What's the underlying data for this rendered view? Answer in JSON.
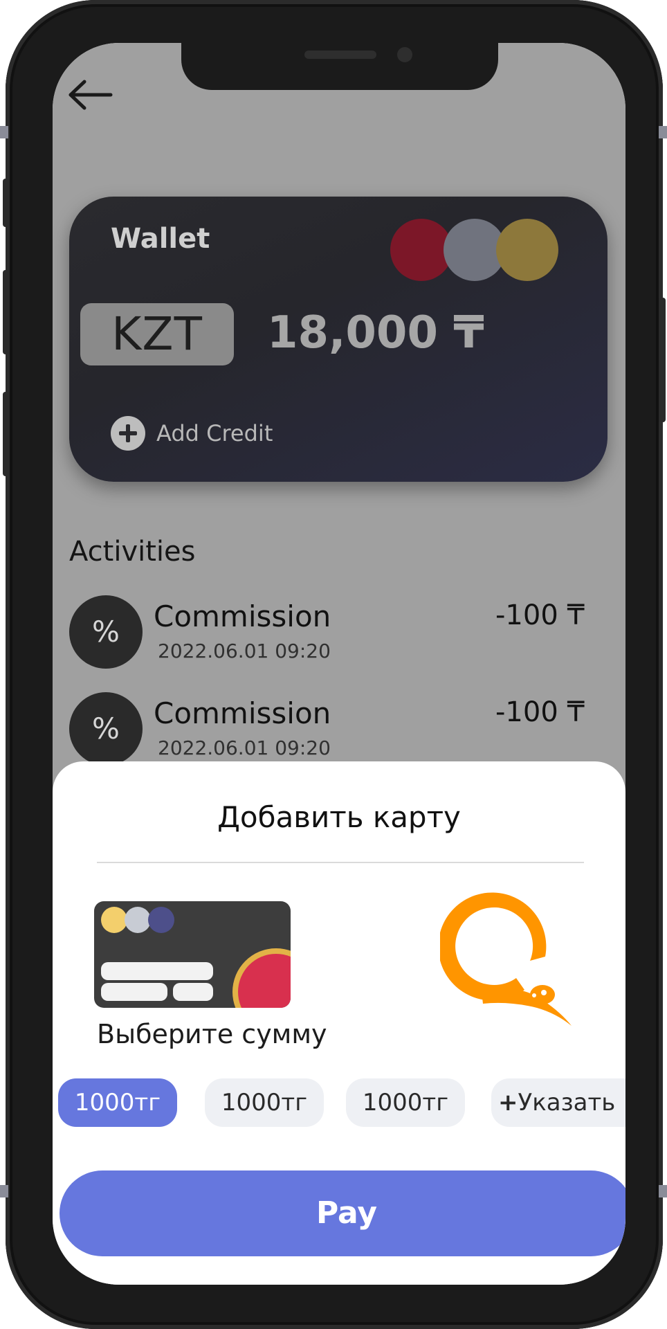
{
  "header": {
    "back_icon": "arrow-left-icon"
  },
  "wallet_card": {
    "title": "Wallet",
    "currency": "KZT",
    "balance": "18,000 ₸",
    "add_credit_label": "Add Credit",
    "circle_colors": [
      "#7c1728",
      "#70737e",
      "#8d783b"
    ]
  },
  "activities": {
    "heading": "Activities",
    "items": [
      {
        "title": "Commission",
        "datetime": "2022.06.01  09:20",
        "amount": "-100 ₸",
        "icon": "percent-icon"
      },
      {
        "title": "Commission",
        "datetime": "2022.06.01  09:20",
        "amount": "-100 ₸",
        "icon": "percent-icon"
      }
    ]
  },
  "sheet": {
    "title": "Добавить карту",
    "card_option_icon": "bank-card-icon",
    "qiwi_option_icon": "qiwi-logo-icon",
    "choose_amount": "Выберите сумму",
    "amounts": [
      {
        "label": "1000тг",
        "selected": true
      },
      {
        "label": "1000тг",
        "selected": false
      },
      {
        "label": "1000тг",
        "selected": false
      },
      {
        "label": "Указать",
        "selected": false
      }
    ],
    "pay_label": "Pay"
  },
  "colors": {
    "accent": "#6677de",
    "qiwi_orange": "#ff9500"
  }
}
